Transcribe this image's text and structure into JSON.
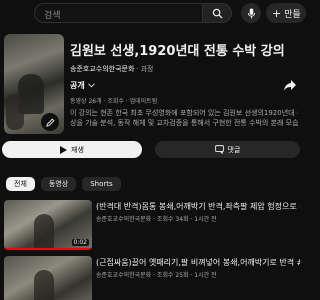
{
  "header": {
    "search_placeholder": "검색",
    "create_label": "만들"
  },
  "playlist": {
    "title": "김원보 선생,1920년대 전통 수박 강의",
    "channel": "송준호교수의한국문화",
    "channel_suffix": "· 과정",
    "visibility": "공개",
    "meta": "동영상 26개 · 조회수 · 업데이트됨",
    "description_lines": [
      "이 강의는 현존 한국 최초 무성영화에 포함되어 있는 김원보 선생의1920년대 수박 영",
      "상을 기술 분석, 동작 해체 및 교차검증을 통해서 구현한 전통 수박의 본래 모습을 ...더"
    ],
    "play_label": "재생",
    "comment_label": "댓글"
  },
  "chips": [
    "전체",
    "동영상",
    "Shorts"
  ],
  "videos": [
    {
      "title": "(반격대 반격)몸통 봉쇄,어깨박기 반격,좌측팔 제압 험정으로 누르...",
      "meta": "송준호교수의한국문화 · 조회수 34회 · 1시간 전",
      "duration": "0:02",
      "progress": 1.0
    },
    {
      "title": "(근접싸움)끌어 옛패리기,팔 비껴넣어 봉쇄,어깨박기로 반격 #전...",
      "meta": "송준호교수의한국문화 · 조회수 25회 · 1시간 전",
      "duration": "",
      "progress": 0
    }
  ],
  "colors": {
    "background": "#0f0f0f",
    "progress_red": "#ff0000",
    "button_light": "#f1f1f1",
    "button_dark": "#272727"
  }
}
